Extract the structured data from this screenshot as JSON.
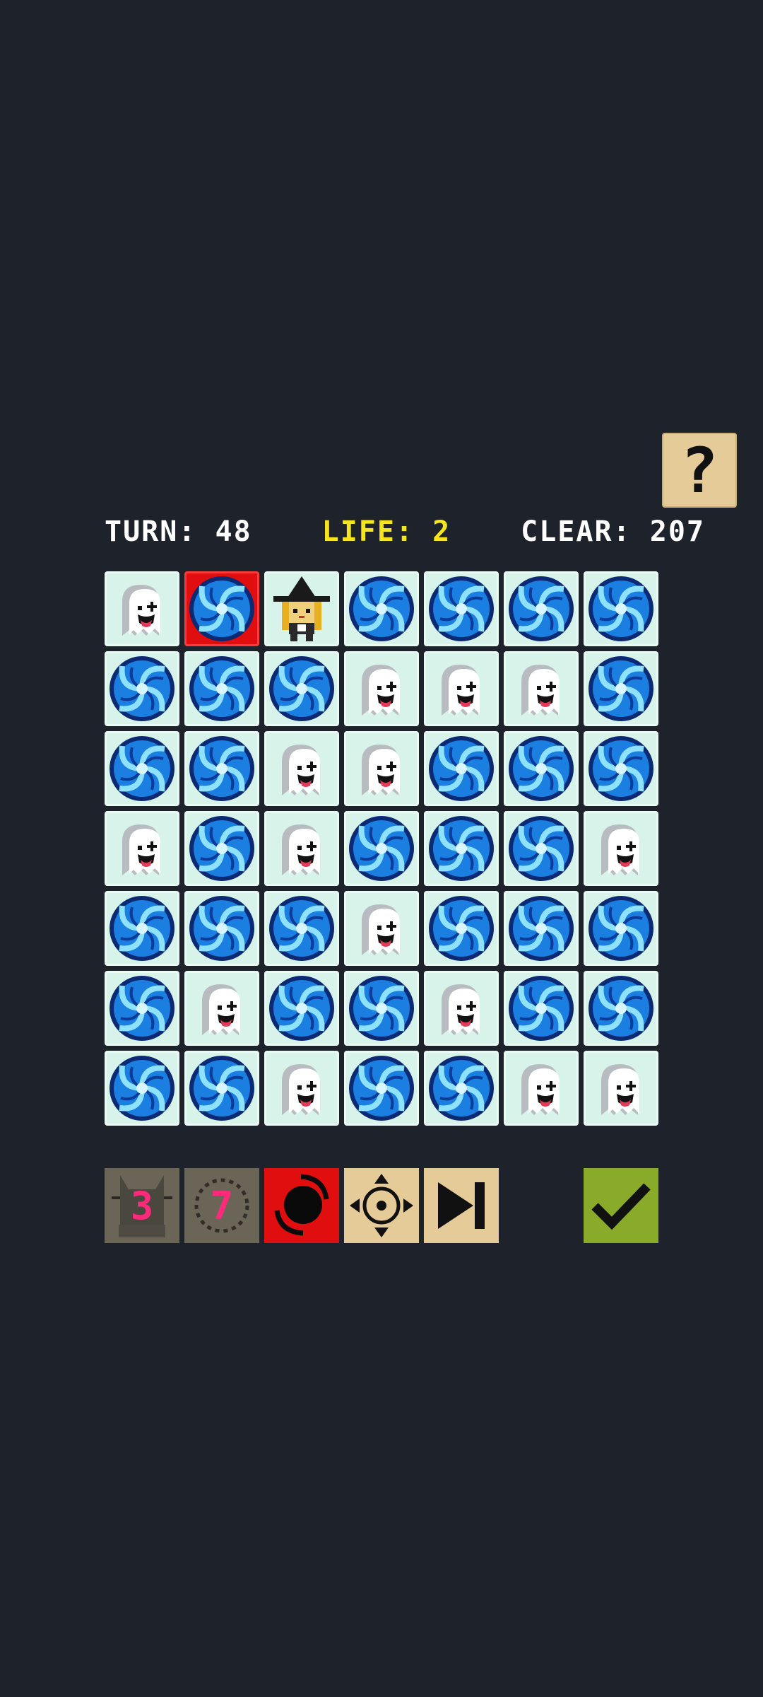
{
  "header": {
    "help_label": "?"
  },
  "status": {
    "turn_label": "TURN:",
    "turn_value": "48",
    "life_label": "LIFE:",
    "life_value": "2",
    "clear_label": "CLEAR:",
    "clear_value": "207"
  },
  "colors": {
    "background": "#1e232b",
    "life": "#f5e51e",
    "tile_bg": "#d7f3ea",
    "selected": "#e00e0e",
    "vortex": "#1a7fe0",
    "tool_tan": "#e5cb98",
    "tool_gray": "#6b6558",
    "confirm": "#8aab2a",
    "counter": "#ff2a7a"
  },
  "board": {
    "legend": {
      "G": "ghost-icon",
      "V": "vortex-icon",
      "W": "witch-icon"
    },
    "selected_cell": [
      0,
      1
    ],
    "rows": [
      [
        "G",
        "V",
        "W",
        "V",
        "V",
        "V",
        "V"
      ],
      [
        "V",
        "V",
        "V",
        "G",
        "G",
        "G",
        "V"
      ],
      [
        "V",
        "V",
        "G",
        "G",
        "V",
        "V",
        "V"
      ],
      [
        "G",
        "V",
        "G",
        "V",
        "V",
        "V",
        "G"
      ],
      [
        "V",
        "V",
        "V",
        "G",
        "V",
        "V",
        "V"
      ],
      [
        "V",
        "G",
        "V",
        "V",
        "G",
        "V",
        "V"
      ],
      [
        "V",
        "V",
        "G",
        "V",
        "V",
        "G",
        "G"
      ]
    ]
  },
  "toolbar": {
    "items": [
      {
        "icon": "cat-counter-icon",
        "count": "3",
        "state": "disabled"
      },
      {
        "icon": "ring-counter-icon",
        "count": "7",
        "state": "disabled"
      },
      {
        "icon": "black-hole-icon",
        "state": "active"
      },
      {
        "icon": "move-cross-icon",
        "state": "enabled"
      },
      {
        "icon": "skip-turn-icon",
        "state": "enabled"
      },
      {
        "icon": "checkmark-icon",
        "state": "confirm"
      }
    ]
  }
}
